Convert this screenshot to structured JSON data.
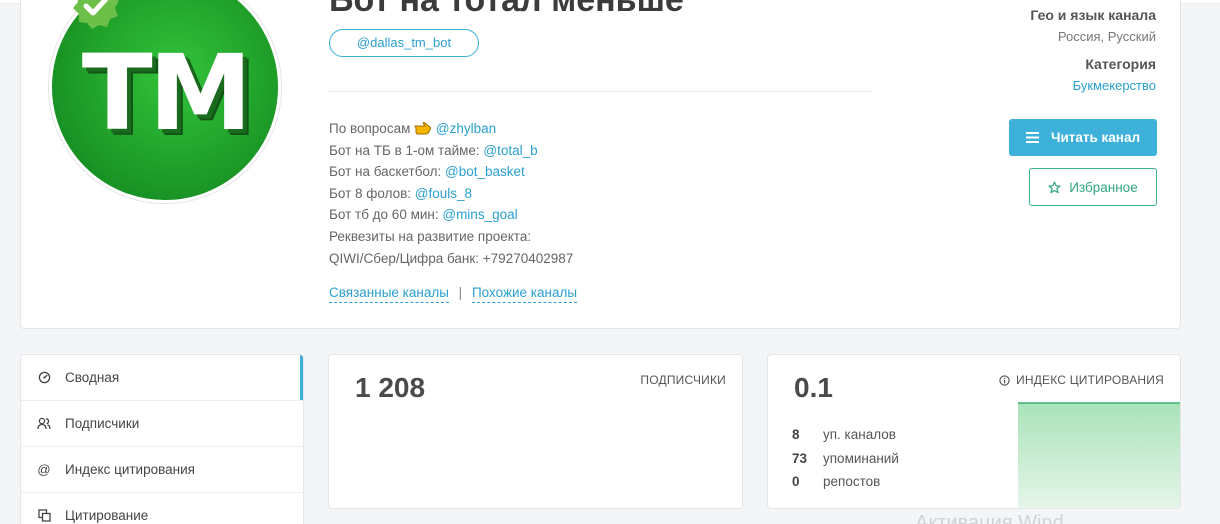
{
  "channel": {
    "title": "Бот на тотал меньше",
    "username": "@dallas_tm_bot",
    "avatar_text": "TM",
    "description": [
      {
        "text": "По вопросам",
        "hand": true,
        "link": "@zhylban"
      },
      {
        "text": "Бот на ТБ в 1-ом тайме: ",
        "link": "@total_b"
      },
      {
        "text": "Бот на баскетбол: ",
        "link": "@bot_basket"
      },
      {
        "text": "Бот 8 фолов: ",
        "link": "@fouls_8"
      },
      {
        "text": "Бот тб до 60 мин: ",
        "link": "@mins_goal"
      },
      {
        "text": "Реквезиты на развитие проекта:",
        "link": ""
      },
      {
        "text": "QIWI/Сбер/Цифра банк: +79270402987",
        "link": ""
      }
    ],
    "related_label": "Связанные каналы",
    "similar_label": "Похожие каналы",
    "separator": "|"
  },
  "meta": {
    "geo_label": "Гео и язык канала",
    "geo_value": "Россия, Русский",
    "category_label": "Категория",
    "category_value": "Букмекерство"
  },
  "actions": {
    "read_label": "Читать канал",
    "favorite_label": "Избранное"
  },
  "sidebar": {
    "items": [
      {
        "label": "Сводная",
        "icon": "dashboard-icon",
        "active": true
      },
      {
        "label": "Подписчики",
        "icon": "users-icon",
        "active": false
      },
      {
        "label": "Индекс цитирования",
        "icon": "at-icon",
        "active": false
      },
      {
        "label": "Цитирование",
        "icon": "copy-icon",
        "active": false
      }
    ]
  },
  "stats": {
    "subscribers_value": "1 208",
    "subscribers_label": "ПОДПИСЧИКИ",
    "citation_value": "0.1",
    "citation_label": "ИНДЕКС ЦИТИРОВАНИЯ",
    "citation_rows": [
      {
        "n": "8",
        "label": "уп. каналов"
      },
      {
        "n": "73",
        "label": "упоминаний"
      },
      {
        "n": "0",
        "label": "репостов"
      }
    ]
  },
  "watermark": "Активация Wind",
  "colors": {
    "accent": "#3db1d9",
    "favorite": "#3bb08a",
    "avatar": "#22a52c",
    "chart_fill": "#c8ecd2"
  }
}
